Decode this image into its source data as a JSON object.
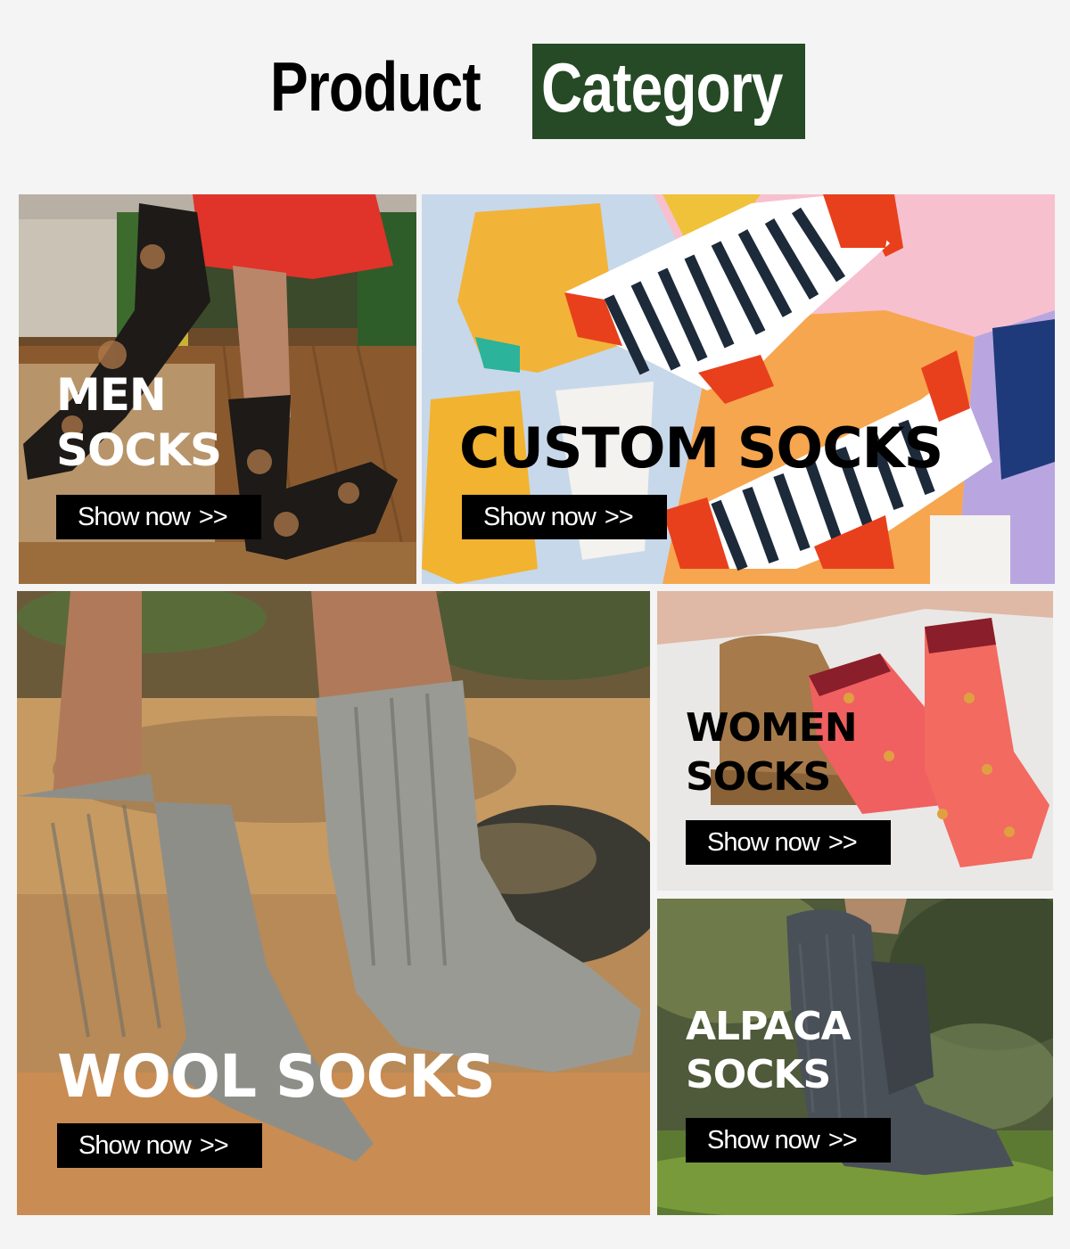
{
  "header": {
    "word1": "Product",
    "word2": "Category",
    "accent_color": "#254a25"
  },
  "tiles": [
    {
      "id": "men",
      "line1": "MEN",
      "line2": "SOCKS",
      "button": "Show now",
      "arrow": ">>"
    },
    {
      "id": "custom",
      "line1": "CUSTOM SOCKS",
      "button": "Show now",
      "arrow": ">>"
    },
    {
      "id": "wool",
      "line1": "WOOL SOCKS",
      "button": "Show now",
      "arrow": ">>"
    },
    {
      "id": "women",
      "line1": "WOMEN",
      "line2": "SOCKS",
      "button": "Show now",
      "arrow": ">>"
    },
    {
      "id": "alpaca",
      "line1": "ALPACA",
      "line2": "SOCKS",
      "button": "Show now",
      "arrow": ">>"
    }
  ]
}
